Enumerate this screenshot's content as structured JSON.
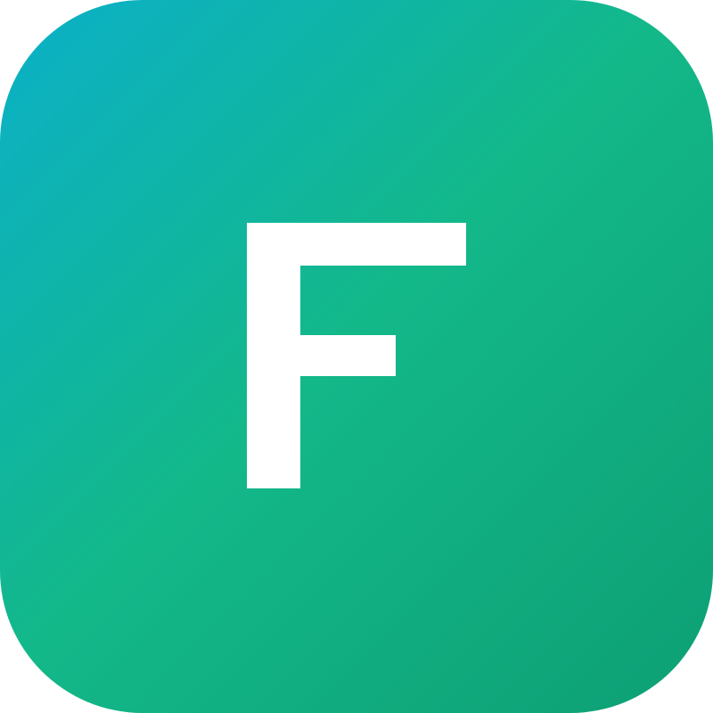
{
  "app_icon": {
    "letter": "F",
    "colors": {
      "gradient_start": "#0bb0c9",
      "gradient_mid": "#13b889",
      "gradient_end": "#0d9f74",
      "letter_color": "#ffffff"
    }
  }
}
